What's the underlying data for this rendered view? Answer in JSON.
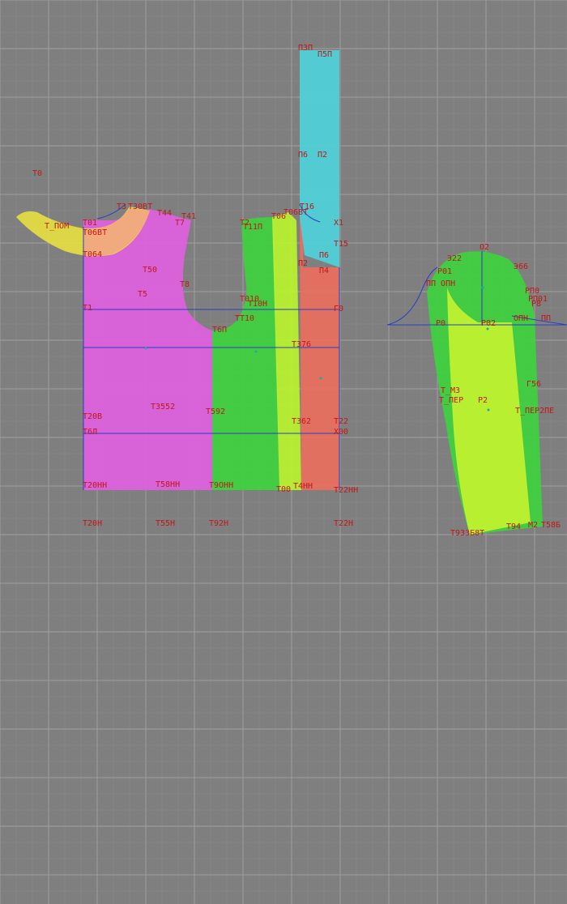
{
  "app": {
    "name": "pattern-cad-drawing-canvas"
  },
  "colors": {
    "background": "#7f7f7f",
    "grid_major": "#9a9a9a",
    "grid_minor": "#8c8c8c",
    "back_piece": "#e060e0",
    "side_piece": "#40d040",
    "lining_strip": "#b8f030",
    "front_piece": "#e87060",
    "facing_strip": "#50d0d8",
    "collar": "#e8e040",
    "collar_overlap": "#f0a880",
    "sleeve_outer": "#40d040",
    "sleeve_inner": "#c0f030",
    "construction_line": "#2a3fbf",
    "label": "#c01818"
  },
  "labels": {
    "t0": "T0",
    "t_pom": "T_ПОМ",
    "t01": "T01",
    "t06bt": "T06BT",
    "t064": "T064",
    "t3": "T3",
    "t30bt": "T30BT",
    "t44": "T44",
    "t41": "T41",
    "t7": "T7",
    "t50": "T50",
    "t5": "T5",
    "t8": "T8",
    "t1": "T1",
    "t6p": "T6П",
    "t2": "T2",
    "t11p": "T11П",
    "t06": "T06",
    "t16": "T16",
    "t06bt_2": "T06BT",
    "x1": "X1",
    "t15": "T15",
    "p6": "П6",
    "p2": "П2",
    "p4": "П4",
    "t010": "T010",
    "t10h": "T10H",
    "tt10": "TT10",
    "g0": "Г0",
    "t376": "T376",
    "t35_52": "T3552",
    "t592": "T592",
    "t20b": "T20B",
    "t6l": "T6Л",
    "t362": "T362",
    "t22": "T22",
    "x00": "X00",
    "t20nn": "T20НН",
    "t58nn": "T58НН",
    "t9onn": "T9ОНН",
    "t00": "T00",
    "t4nn": "T4НН",
    "t22nn": "T22НН",
    "t20n": "T20Н",
    "t55n": "T55Н",
    "t92n": "T92Н",
    "t22n": "T22Н",
    "p3p": "П3П",
    "p5p": "П5П",
    "p6_2": "П6",
    "p2_2": "П2",
    "o2": "O2",
    "s22": "Э22",
    "s66": "Э66",
    "r01": "Р01",
    "pp_opn": "ПП ОПН",
    "rp0": "РП0",
    "rp01": "РП01",
    "r8": "Р8",
    "r0": "Р0",
    "r02": "Р02",
    "opn": "ОПН",
    "pp": "ПП",
    "r56": "Г56",
    "t_m3": "Т_МЗ",
    "t_per": "Т_ПЕР",
    "r2": "Р2",
    "t_per2": "T_ПЕР2ПЕ",
    "t9_bottom": "T9ЗЗБ8Т",
    "t94": "T94",
    "m2": "M2",
    "t58b": "T58Б"
  }
}
